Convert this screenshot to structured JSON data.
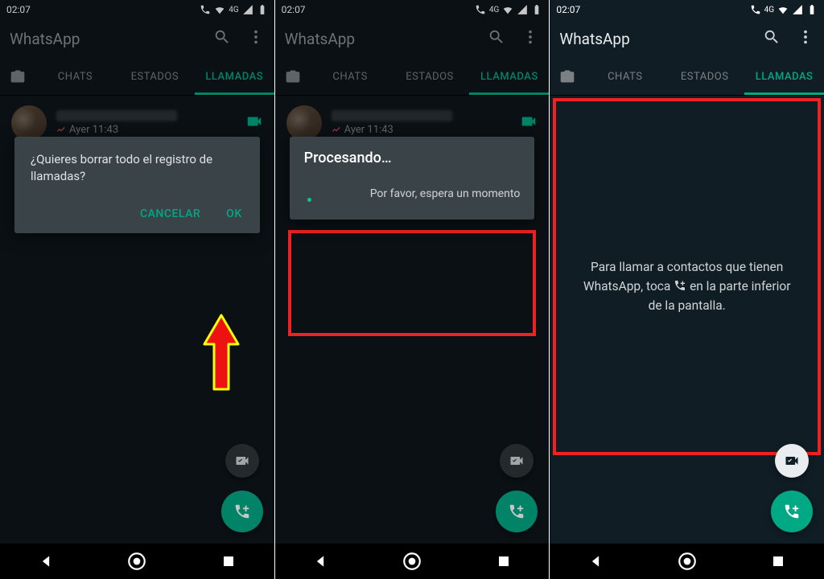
{
  "statusbar": {
    "time": "02:07",
    "net_label": "4G"
  },
  "app": {
    "title": "WhatsApp"
  },
  "tabs": {
    "chats": "CHATS",
    "status": "ESTADOS",
    "calls": "LLAMADAS"
  },
  "call_entry": {
    "time": "Ayer 11:43"
  },
  "dialog_delete": {
    "message": "¿Quieres borrar todo el registro de llamadas?",
    "cancel": "CANCELAR",
    "ok": "OK"
  },
  "dialog_processing": {
    "title": "Procesando…",
    "subtitle": "Por favor, espera un momento"
  },
  "empty_state": {
    "line1": "Para llamar a contactos que tienen",
    "line2a": "WhatsApp, toca",
    "line2b": "en la parte inferior",
    "line3": "de la pantalla."
  }
}
